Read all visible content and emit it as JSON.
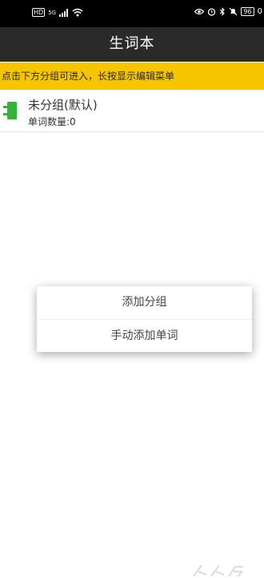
{
  "status_bar": {
    "left_badges": [
      "HD",
      "5G"
    ],
    "battery": "96",
    "time": "0"
  },
  "title_bar": {
    "title": "生词本"
  },
  "hint_banner": {
    "text": "点击下方分组可进入，长按显示编辑菜单"
  },
  "groups": [
    {
      "name": "未分组(默认)",
      "count_label": "单词数量:0"
    }
  ],
  "popup_menu": {
    "items": [
      {
        "label": "添加分组"
      },
      {
        "label": "手动添加单词"
      }
    ]
  },
  "colors": {
    "accent_yellow": "#f7c500",
    "title_bg": "#2a2a2a",
    "icon_green": "#35b23a"
  }
}
